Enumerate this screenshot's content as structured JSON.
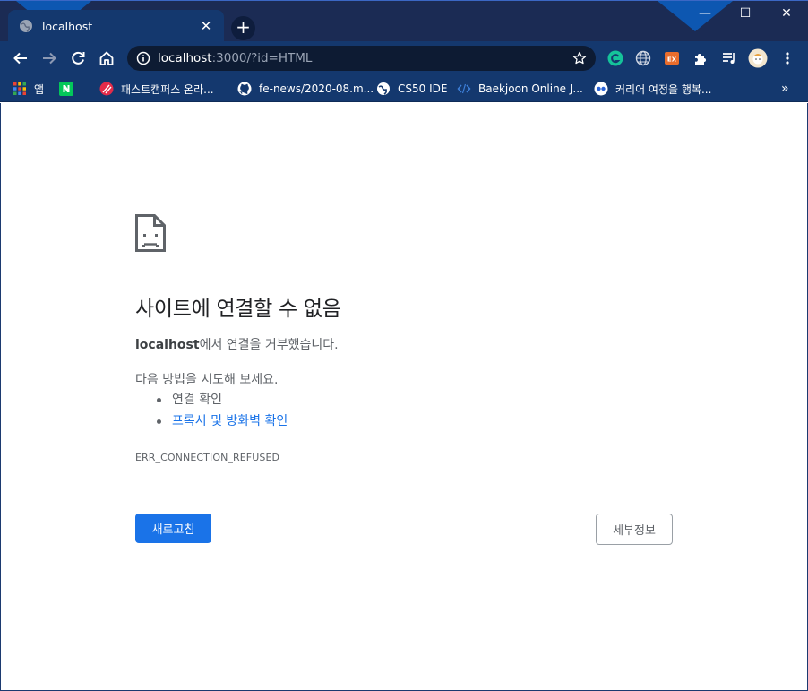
{
  "browser": {
    "tab": {
      "title": "localhost",
      "favicon": "globe-icon",
      "close_icon": "close-icon"
    },
    "new_tab_icon": "plus-icon",
    "window_controls": {
      "minimize": "—",
      "maximize": "☐",
      "close": "✕"
    },
    "omnibox": {
      "host": "localhost",
      "rest": ":3000/?id=HTML",
      "info_icon": "info-icon",
      "bookmark_icon": "star-icon"
    },
    "extensions": [
      "grammarly-icon",
      "globe-icon",
      "ex-icon",
      "puzzle-icon",
      "playlist-icon",
      "profile-avatar",
      "menu-icon"
    ],
    "bookmarks": [
      {
        "label": "앱",
        "icon": "apps-grid-icon"
      },
      {
        "label": "",
        "icon": "naver-icon"
      },
      {
        "label": "패스트캠퍼스 온라...",
        "icon": "fastcampus-icon"
      },
      {
        "label": "fe-news/2020-08.m...",
        "icon": "github-icon"
      },
      {
        "label": "CS50 IDE",
        "icon": "globe-icon"
      },
      {
        "label": "Baekjoon Online J...",
        "icon": "code-icon"
      },
      {
        "label": "커리어 여정을 행복...",
        "icon": "career-icon"
      }
    ],
    "more_bookmarks": "»",
    "colors": {
      "frame": "#1b2b54",
      "toolbar": "#14386e",
      "omnibox": "#0d1b33",
      "accent": "#0a5fc2"
    }
  },
  "error_page": {
    "title": "사이트에 연결할 수 없음",
    "message_host": "localhost",
    "message_rest": "에서 연결을 거부했습니다.",
    "try_label": "다음 방법을 시도해 보세요.",
    "suggestions": [
      {
        "text": "연결 확인",
        "link": false
      },
      {
        "text": "프록시 및 방화벽 확인",
        "link": true
      }
    ],
    "error_code": "ERR_CONNECTION_REFUSED",
    "reload_button": "새로고침",
    "details_button": "세부정보",
    "colors": {
      "primary": "#1a73e8",
      "text": "#5f6368",
      "heading": "#202124"
    }
  }
}
